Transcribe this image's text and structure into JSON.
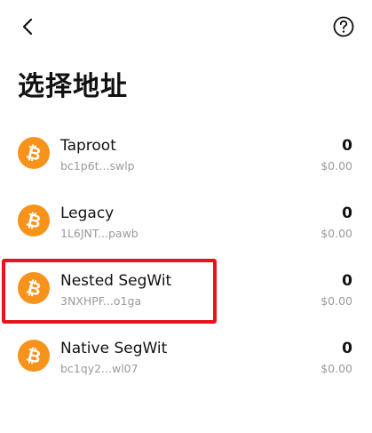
{
  "header": {
    "back_icon": "chevron-left-icon",
    "help_icon": "question-circle-icon",
    "title": "选择地址"
  },
  "colors": {
    "bitcoin_orange": "#F7931A",
    "highlight_red": "#E8141A",
    "secondary_text": "#9A9A9A"
  },
  "addresses": [
    {
      "name": "Taproot",
      "address": "bc1p6t...swlp",
      "amount": "0",
      "fiat": "$0.00",
      "icon": "bitcoin-icon"
    },
    {
      "name": "Legacy",
      "address": "1L6JNT...pawb",
      "amount": "0",
      "fiat": "$0.00",
      "icon": "bitcoin-icon"
    },
    {
      "name": "Nested SegWit",
      "address": "3NXHPF...o1ga",
      "amount": "0",
      "fiat": "$0.00",
      "icon": "bitcoin-icon",
      "highlighted": true
    },
    {
      "name": "Native SegWit",
      "address": "bc1qy2...wl07",
      "amount": "0",
      "fiat": "$0.00",
      "icon": "bitcoin-icon"
    }
  ]
}
